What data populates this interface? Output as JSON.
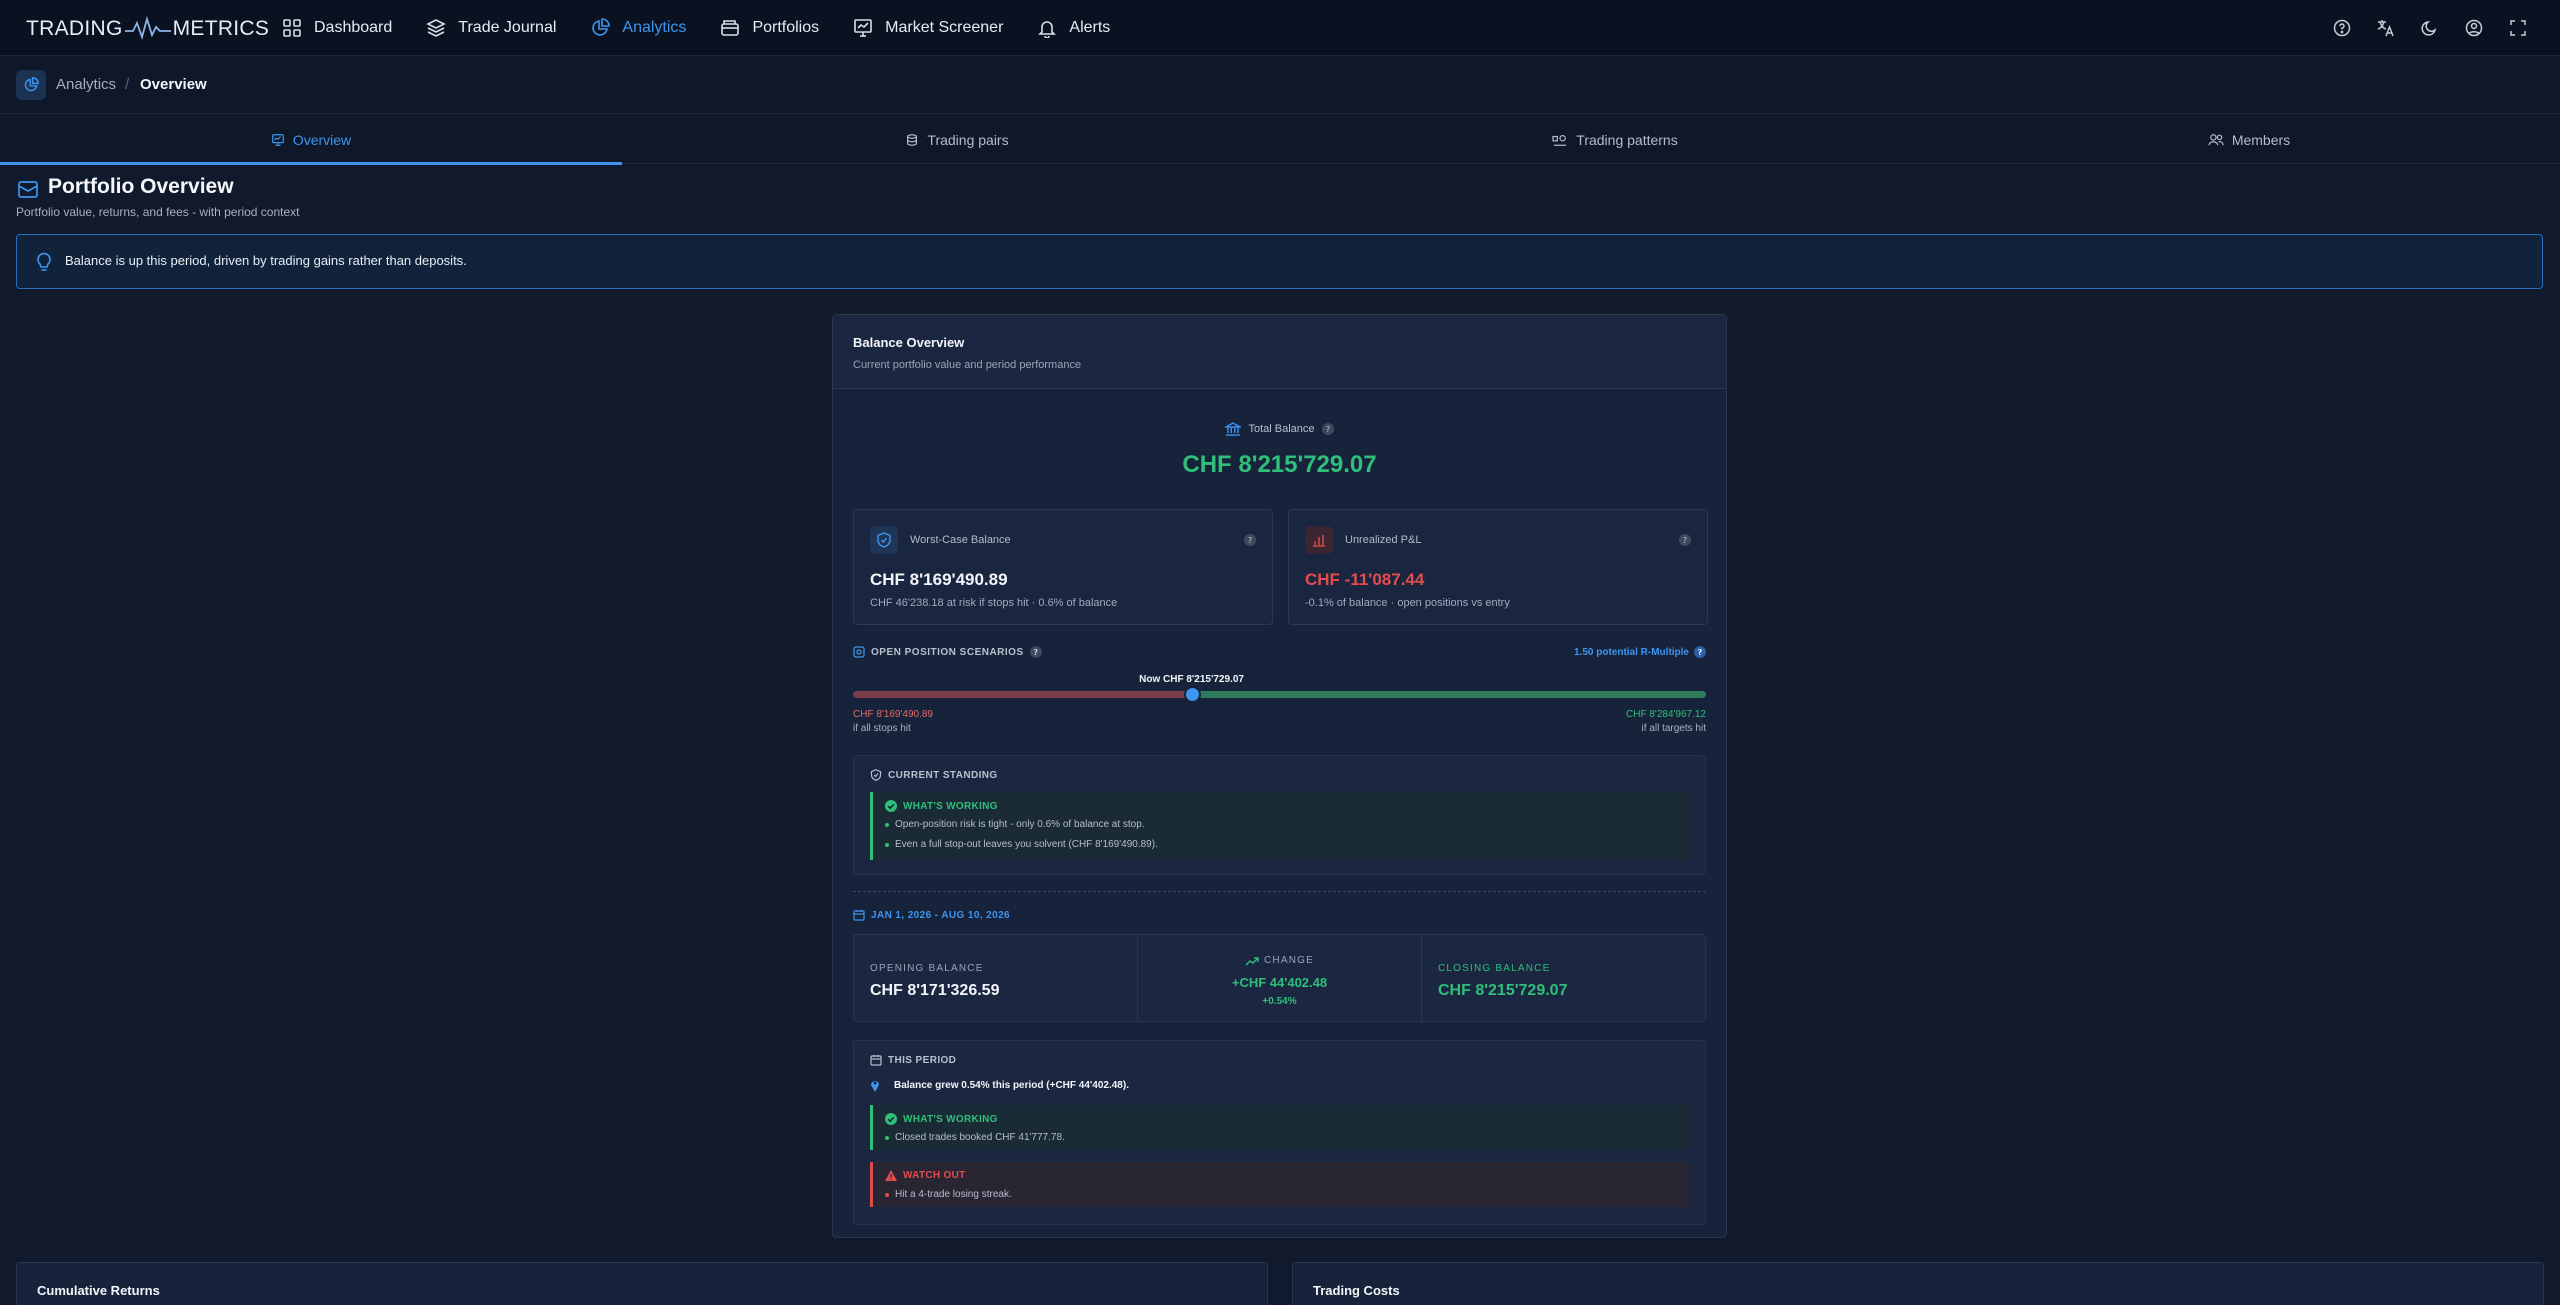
{
  "app": {
    "logo_left": "TRADING",
    "logo_right": "METRICS"
  },
  "nav": {
    "items": [
      {
        "label": "Dashboard",
        "icon": "grid-icon"
      },
      {
        "label": "Trade Journal",
        "icon": "layers-icon"
      },
      {
        "label": "Analytics",
        "icon": "pie-chart-icon",
        "active": true
      },
      {
        "label": "Portfolios",
        "icon": "wallet-icon"
      },
      {
        "label": "Market Screener",
        "icon": "screener-icon"
      },
      {
        "label": "Alerts",
        "icon": "bell-icon"
      }
    ],
    "right_icons": [
      "help-icon",
      "translate-icon",
      "moon-icon",
      "user-circle-icon",
      "fullscreen-icon"
    ]
  },
  "breadcrumb": {
    "root": "Analytics",
    "separator": "/",
    "current": "Overview"
  },
  "tabs": [
    {
      "label": "Overview",
      "icon": "monitor-icon",
      "active": true
    },
    {
      "label": "Trading pairs",
      "icon": "coins-icon"
    },
    {
      "label": "Trading patterns",
      "icon": "patterns-icon"
    },
    {
      "label": "Members",
      "icon": "users-icon"
    }
  ],
  "page": {
    "title": "Portfolio Overview",
    "subtitle": "Portfolio value, returns, and fees - with period context",
    "insight": "Balance is up this period, driven by trading gains rather than deposits."
  },
  "balance_card": {
    "title": "Balance Overview",
    "subtitle": "Current portfolio value and period performance",
    "total_label": "Total Balance",
    "total_value": "CHF 8'215'729.07",
    "worst_case": {
      "label": "Worst-Case Balance",
      "value": "CHF 8'169'490.89",
      "note": "CHF 46'238.18 at risk if stops hit · 0.6% of balance"
    },
    "unrealized": {
      "label": "Unrealized P&L",
      "value": "CHF -11'087.44",
      "note": "-0.1% of balance · open positions vs entry"
    },
    "scenarios": {
      "heading": "OPEN POSITION SCENARIOS",
      "r_multiple": "1.50 potential R-Multiple",
      "now_label": "Now CHF 8'215'729.07",
      "now_fraction": 0.397,
      "left_value": "CHF 8'169'490.89",
      "left_note": "if all stops hit",
      "right_value": "CHF 8'284'967.12",
      "right_note": "if all targets hit"
    },
    "standing": {
      "heading": "CURRENT STANDING",
      "working_title": "WHAT'S WORKING",
      "working_items": [
        "Open-position risk is tight - only 0.6% of balance at stop.",
        "Even a full stop-out leaves you solvent (CHF 8'169'490.89)."
      ]
    },
    "period": {
      "range": "JAN 1, 2026 - AUG 10, 2026",
      "opening_label": "OPENING BALANCE",
      "opening_value": "CHF 8'171'326.59",
      "change_label": "CHANGE",
      "change_value": "+CHF 44'402.48",
      "change_pct": "+0.54%",
      "closing_label": "CLOSING BALANCE",
      "closing_value": "CHF 8'215'729.07"
    },
    "this_period": {
      "heading": "THIS PERIOD",
      "summary": "Balance grew 0.54% this period (+CHF 44'402.48).",
      "working_title": "WHAT'S WORKING",
      "working_items": [
        "Closed trades booked CHF 41'777.78."
      ],
      "watch_title": "WATCH OUT",
      "watch_items": [
        "Hit a 4-trade losing streak."
      ]
    }
  },
  "bottom_cards": {
    "left_title": "Cumulative Returns",
    "right_title": "Trading Costs"
  },
  "colors": {
    "accent": "#3d95f0",
    "positive": "#2fbf7a",
    "negative": "#e24d4d",
    "background": "#101a2c"
  }
}
